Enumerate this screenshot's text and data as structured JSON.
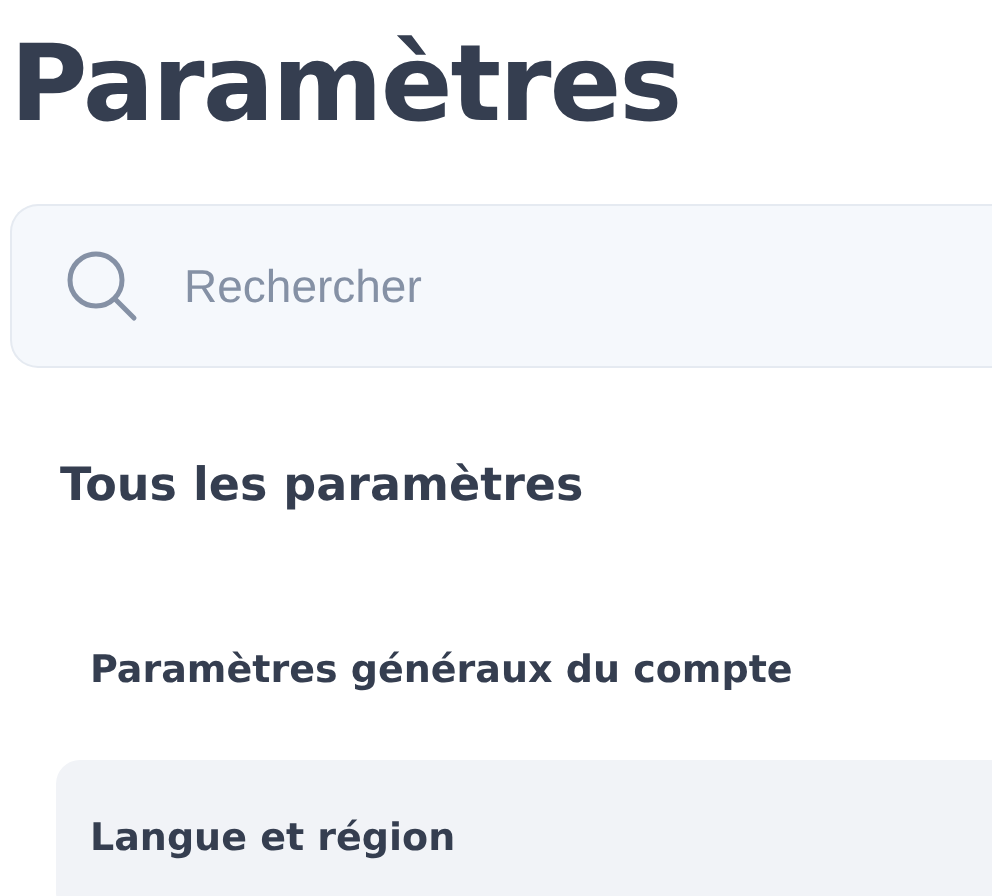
{
  "title": "Paramètres",
  "search": {
    "placeholder": "Rechercher"
  },
  "section": {
    "heading": "Tous les paramètres",
    "items": [
      {
        "label": "Paramètres généraux du compte",
        "selected": false
      },
      {
        "label": "Langue et région",
        "selected": true
      }
    ]
  }
}
